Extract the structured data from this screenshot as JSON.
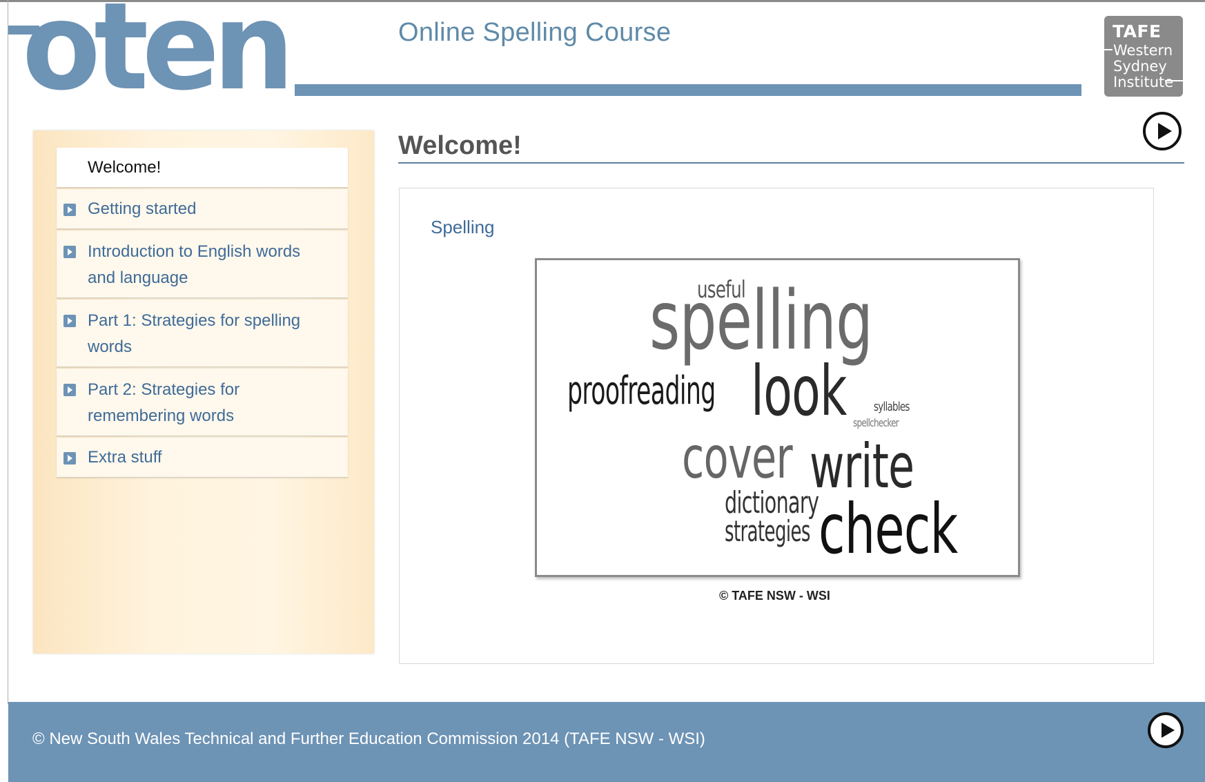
{
  "header": {
    "logo_text": "oten",
    "course_title": "Online Spelling Course",
    "institution_logo": {
      "brand": "TAFE",
      "line1": "Western",
      "line2": "Sydney",
      "line3": "Institute"
    },
    "next_icon": "play-circle-icon"
  },
  "sidebar": {
    "items": [
      {
        "label": "Welcome!",
        "active": true,
        "has_bullet": false
      },
      {
        "label": "Getting started",
        "active": false,
        "has_bullet": true
      },
      {
        "label": "Introduction to English words",
        "label2": "and language",
        "active": false,
        "has_bullet": true
      },
      {
        "label": "Part 1: Strategies for spelling",
        "label2": "words",
        "active": false,
        "has_bullet": true
      },
      {
        "label": "Part 2: Strategies for",
        "label2": "remembering words",
        "active": false,
        "has_bullet": true
      },
      {
        "label": "Extra stuff",
        "active": false,
        "has_bullet": true
      }
    ]
  },
  "main": {
    "heading": "Welcome!",
    "section_label": "Spelling",
    "word_cloud": {
      "useful": "useful",
      "spelling": "spelling",
      "proofreading": "proofreading",
      "look": "look",
      "syllables": "syllables",
      "spellchecker": "spellchecker",
      "cover": "cover",
      "write": "write",
      "dictionary": "dictionary",
      "strategies": "strategies",
      "check": "check"
    },
    "image_caption": "© TAFE NSW - WSI"
  },
  "footer": {
    "copyright": "© New South Wales Technical and Further Education Commission 2014 (TAFE NSW - WSI)",
    "next_icon": "play-circle-icon"
  },
  "colors": {
    "brand_blue": "#6d93b5",
    "link_blue": "#3f6b98",
    "sidebar_bg": "#fff3dd",
    "logo_gray": "#8a8a8a"
  }
}
